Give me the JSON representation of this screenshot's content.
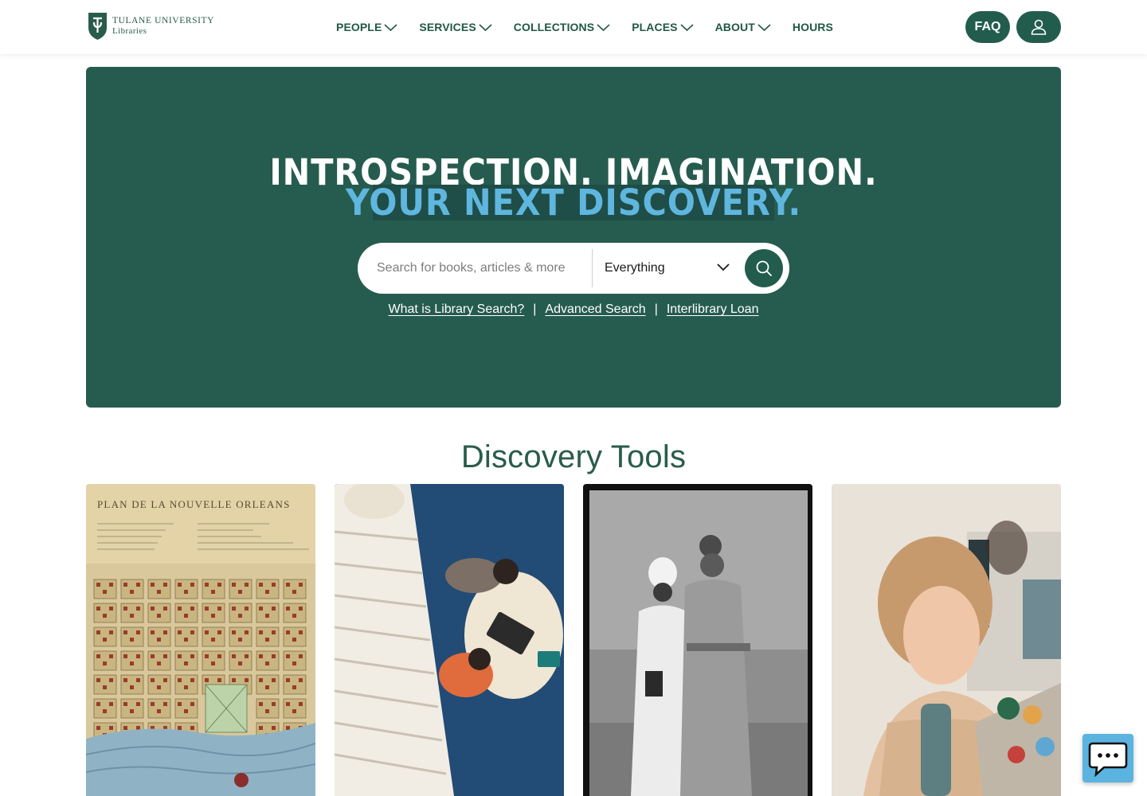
{
  "brand": {
    "name": "TULANE UNIVERSITY",
    "sub": "Libraries"
  },
  "nav": {
    "items": [
      {
        "label": "PEOPLE",
        "has_menu": true
      },
      {
        "label": "SERVICES",
        "has_menu": true
      },
      {
        "label": "COLLECTIONS",
        "has_menu": true
      },
      {
        "label": "PLACES",
        "has_menu": true
      },
      {
        "label": "ABOUT",
        "has_menu": true
      },
      {
        "label": "HOURS",
        "has_menu": false
      }
    ],
    "faq_label": "FAQ",
    "account_icon": "user-icon"
  },
  "hero": {
    "line1": "INTROSPECTION. IMAGINATION.",
    "line2": "YOUR NEXT DISCOVERY.",
    "search": {
      "placeholder": "Search for books, articles & more",
      "value": "",
      "scope": "Everything",
      "submit_icon": "search-icon"
    },
    "links": [
      {
        "label": "What is Library Search?"
      },
      {
        "label": "Advanced Search"
      },
      {
        "label": "Interlibrary Loan"
      }
    ],
    "separator": "|"
  },
  "discovery": {
    "title": "Discovery Tools",
    "cards": [
      {
        "image": "historic-map-image",
        "caption_text": "PLAN DE LA NOUVELLE ORLEANS"
      },
      {
        "image": "students-studying-image"
      },
      {
        "image": "archival-photo-image"
      },
      {
        "image": "student-laptop-image"
      }
    ]
  },
  "chat": {
    "icon": "chat-icon"
  },
  "colors": {
    "primary_green": "#265c4f",
    "button_green": "#225c4c",
    "accent_blue": "#5fb6de",
    "nav_text": "#215847"
  }
}
